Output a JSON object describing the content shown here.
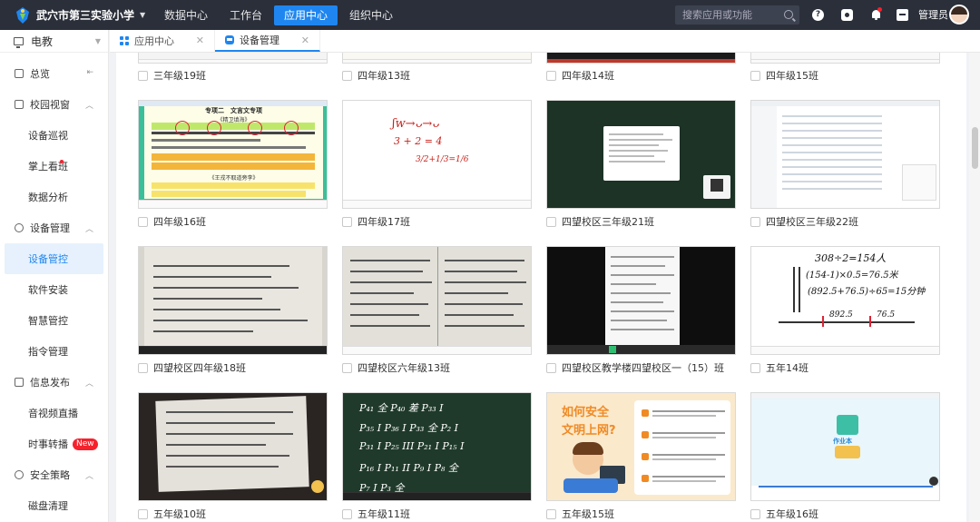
{
  "app": {
    "school_name": "武穴市第三实验小学",
    "nav": [
      "数据中心",
      "工作台",
      "应用中心",
      "组织中心"
    ],
    "active_nav": "应用中心",
    "search_placeholder": "搜索应用或功能",
    "user_name": "管理员"
  },
  "sidebar": {
    "header": "电教",
    "collapse_label": "总览",
    "groups": {
      "campus": "校园视窗",
      "device": "设备管理",
      "info": "信息发布",
      "security": "安全策略"
    },
    "items": {
      "device_patrol": "设备巡视",
      "mobile_view": "掌上看班",
      "data_analysis": "数据分析",
      "device_control": "设备管控",
      "software_install": "软件安装",
      "smart_control": "智慧管控",
      "command_mgmt": "指令管理",
      "av_live": "音视频直播",
      "news_relay": "时事转播",
      "disk_cleanup": "磁盘清理"
    },
    "badge_new": "New"
  },
  "tabs": [
    {
      "label": "应用中心",
      "icon": "grid-icon"
    },
    {
      "label": "设备管理",
      "icon": "device-icon"
    }
  ],
  "rows": [
    [
      "三年级19班",
      "四年级13班",
      "四年级14班",
      "四年级15班"
    ],
    [
      "四年级16班",
      "四年级17班",
      "四望校区三年级21班",
      "四望校区三年级22班"
    ],
    [
      "四望校区四年级18班",
      "四望校区六年级13班",
      "四望校区教学楼四望校区一（15）班",
      "五年14班"
    ],
    [
      "五年级10班",
      "五年级11班",
      "五年级15班",
      "五年级16班"
    ]
  ],
  "thumb_text": {
    "ch_title": "专项二　文言文专项",
    "ch_sub1": "《精卫填海》",
    "ch_sub2": "《王戎不取道旁李》",
    "math1": "3/2+1/3=1/6",
    "math2": "3 + 2 = 4",
    "math3": "308÷2=154人",
    "math4": "(154-1)×0.5=76.5米",
    "math5": "(892.5+76.5)÷65=15分钟",
    "math6": "892.5",
    "math7": "76.5",
    "safety1": "如何安全",
    "safety2": "文明上网?",
    "app_label": "作业本"
  },
  "colors": {
    "accent": "#1f86f0",
    "topbar": "#2b2f3a",
    "badge_red": "#f5222d",
    "board_green": "#1f3a2a",
    "safety_bg": "#fbe9cc",
    "safety_orange": "#f08a24"
  }
}
